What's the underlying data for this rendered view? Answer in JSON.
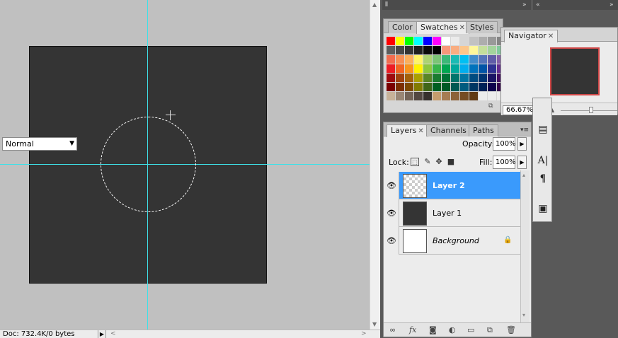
{
  "status": {
    "doc_info": "Doc: 732.4K/0 bytes",
    "arrow_glyph": "▶",
    "scroll_left": "<",
    "scroll_right": ">"
  },
  "swatches_panel": {
    "tabs": [
      {
        "label": "Color"
      },
      {
        "label": "Swatches"
      },
      {
        "label": "Styles"
      }
    ],
    "close_glyph": "✕"
  },
  "navigator": {
    "tab_label": "Navigator",
    "zoom": "66.67%"
  },
  "layers_panel": {
    "tabs": [
      {
        "label": "Layers"
      },
      {
        "label": "Channels"
      },
      {
        "label": "Paths"
      }
    ],
    "blend_mode": "Normal",
    "opacity_label": "Opacity:",
    "opacity_value": "100%",
    "lock_label": "Lock:",
    "fill_label": "Fill:",
    "fill_value": "100%",
    "layers": [
      {
        "name": "Layer 2",
        "selected": true
      },
      {
        "name": "Layer 1",
        "selected": false
      },
      {
        "name": "Background",
        "selected": false,
        "locked": true
      }
    ],
    "footer_icons": [
      "link-icon",
      "fx-icon",
      "mask-icon",
      "adjustment-icon",
      "group-icon",
      "new-layer-icon",
      "trash-icon"
    ]
  },
  "colors": {
    "canvas_bg": "#c0c0c0",
    "document_fill": "#343434",
    "guide": "#3ee0e8",
    "selection_highlight": "#3a9afc",
    "navigator_view_box": "#d04848"
  },
  "swatch_colors": [
    "#ff0000",
    "#ffff00",
    "#00ff00",
    "#00ffff",
    "#0000ff",
    "#ff00ff",
    "#ffffff",
    "#ebebeb",
    "#d6d6d6",
    "#c2c2c2",
    "#adadad",
    "#999999",
    "#858585",
    "#707070",
    "#5c5c5c",
    "#474747",
    "#333333",
    "#1f1f1f",
    "#0a0a0a",
    "#000000",
    "#f7977a",
    "#f9ad81",
    "#fdc68a",
    "#fff79a",
    "#c4df9b",
    "#a3d39c",
    "#82ca9d",
    "#7bcdc8",
    "#f26c4f",
    "#f68e55",
    "#fbaf5c",
    "#fff467",
    "#acd372",
    "#7cc576",
    "#3bb878",
    "#1abbb4",
    "#00bff3",
    "#438ccb",
    "#5574b9",
    "#605ca8",
    "#855fa8",
    "#a763a8",
    "#ed1c24",
    "#f26522",
    "#f7941d",
    "#fff200",
    "#8dc73f",
    "#39b54a",
    "#00a651",
    "#00a99d",
    "#00aeef",
    "#0072bc",
    "#0054a6",
    "#2e3192",
    "#662d91",
    "#92278f",
    "#9e0b0f",
    "#a0410d",
    "#a3620a",
    "#aba000",
    "#598527",
    "#1a7b30",
    "#007236",
    "#00746b",
    "#0076a3",
    "#004b80",
    "#003471",
    "#1b1464",
    "#440e62",
    "#630460",
    "#790000",
    "#7b2e00",
    "#7d4900",
    "#827b00",
    "#406618",
    "#005e20",
    "#005826",
    "#005952",
    "#005b7f",
    "#003663",
    "#002157",
    "#0d004c",
    "#32004b",
    "#4b0049",
    "#c7b299",
    "#998675",
    "#736357",
    "#534741",
    "#37302d",
    "#c69c6d",
    "#a67c52",
    "#8c6239",
    "#754c24",
    "#603913",
    "#ececec",
    "#ececec",
    "#ececec",
    "#ececec"
  ]
}
